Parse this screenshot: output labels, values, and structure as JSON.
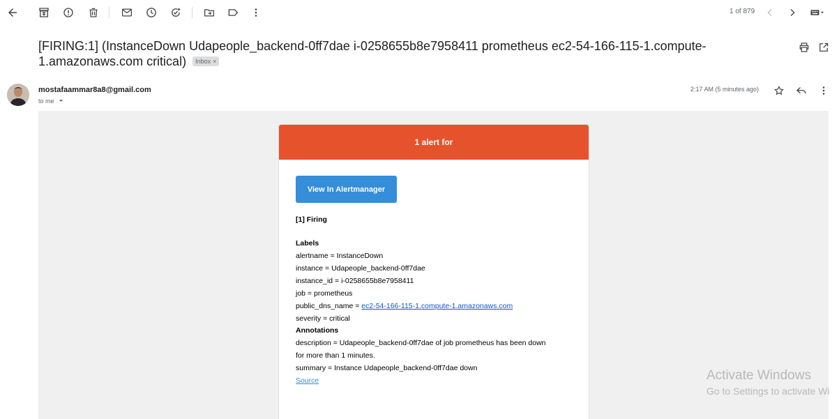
{
  "toolbar": {
    "pager": "1 of 879",
    "icons": [
      "back-arrow-icon",
      "archive-icon",
      "report-spam-icon",
      "delete-icon",
      "mark-unread-icon",
      "snooze-icon",
      "add-task-icon",
      "move-to-icon",
      "label-icon",
      "more-vert-icon",
      "prev-chevron-icon",
      "next-chevron-icon",
      "keyboard-icon"
    ]
  },
  "email": {
    "subject_line1": "[FIRING:1] (InstanceDown Udapeople_backend-0ff7dae i-0258655b8e7958411 prometheus ec2-54-166-115-1.compute-",
    "subject_line2": "1.amazonaws.com critical)",
    "label_chip": "Inbox",
    "chip_close": "×",
    "sender": "mostafaammar8a8@gmail.com",
    "to": "to me",
    "timestamp": "2:17 AM (5 minutes ago)"
  },
  "alert": {
    "header": "1 alert for",
    "button_label": "View In Alertmanager",
    "firing": "[1] Firing",
    "labels_heading": "Labels",
    "alertname": "alertname = InstanceDown",
    "instance": "instance = Udapeople_backend-0ff7dae",
    "instance_id": "instance_id = i-0258655b8e7958411",
    "job": "job = prometheus",
    "public_dns_prefix": "public_dns_name = ",
    "public_dns_link": "ec2-54-166-115-1.compute-1.amazonaws.com",
    "severity": "severity = critical",
    "annotations_heading": "Annotations",
    "description_line1": "description = Udapeople_backend-0ff7dae of job prometheus has been down",
    "description_line2": "for more than 1 minutes.",
    "summary": "summary = Instance Udapeople_backend-0ff7dae down",
    "source_link": "Source"
  },
  "watermark": {
    "line1": "Activate Windows",
    "line2": "Go to Settings to activate Wi"
  },
  "colors": {
    "alert_header": "#e6522c",
    "button": "#348eda",
    "link": "#1155cc"
  }
}
